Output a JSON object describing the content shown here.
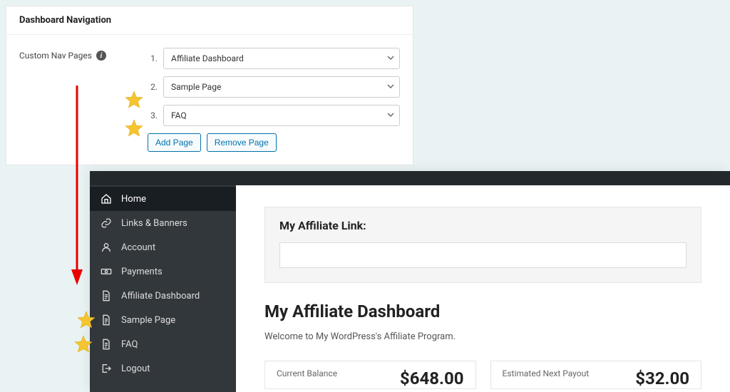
{
  "settings": {
    "panel_title": "Dashboard Navigation",
    "label": "Custom Nav Pages",
    "rows": [
      {
        "num": "1.",
        "value": "Affiliate Dashboard"
      },
      {
        "num": "2.",
        "value": "Sample Page"
      },
      {
        "num": "3.",
        "value": "FAQ"
      }
    ],
    "add_button": "Add Page",
    "remove_button": "Remove Page"
  },
  "dashboard": {
    "sidebar": {
      "items": [
        {
          "icon": "home",
          "label": "Home",
          "active": true
        },
        {
          "icon": "link",
          "label": "Links & Banners"
        },
        {
          "icon": "user",
          "label": "Account"
        },
        {
          "icon": "money",
          "label": "Payments"
        },
        {
          "icon": "doc",
          "label": "Affiliate Dashboard"
        },
        {
          "icon": "doc",
          "label": "Sample Page"
        },
        {
          "icon": "doc",
          "label": "FAQ"
        },
        {
          "icon": "logout",
          "label": "Logout"
        }
      ]
    },
    "link_card_title": "My Affiliate Link:",
    "heading": "My Affiliate Dashboard",
    "welcome": "Welcome to My WordPress's Affiliate Program.",
    "stats": [
      {
        "label": "Current Balance",
        "value": "$648.00"
      },
      {
        "label": "Estimated Next Payout",
        "value": "$32.00"
      }
    ]
  }
}
